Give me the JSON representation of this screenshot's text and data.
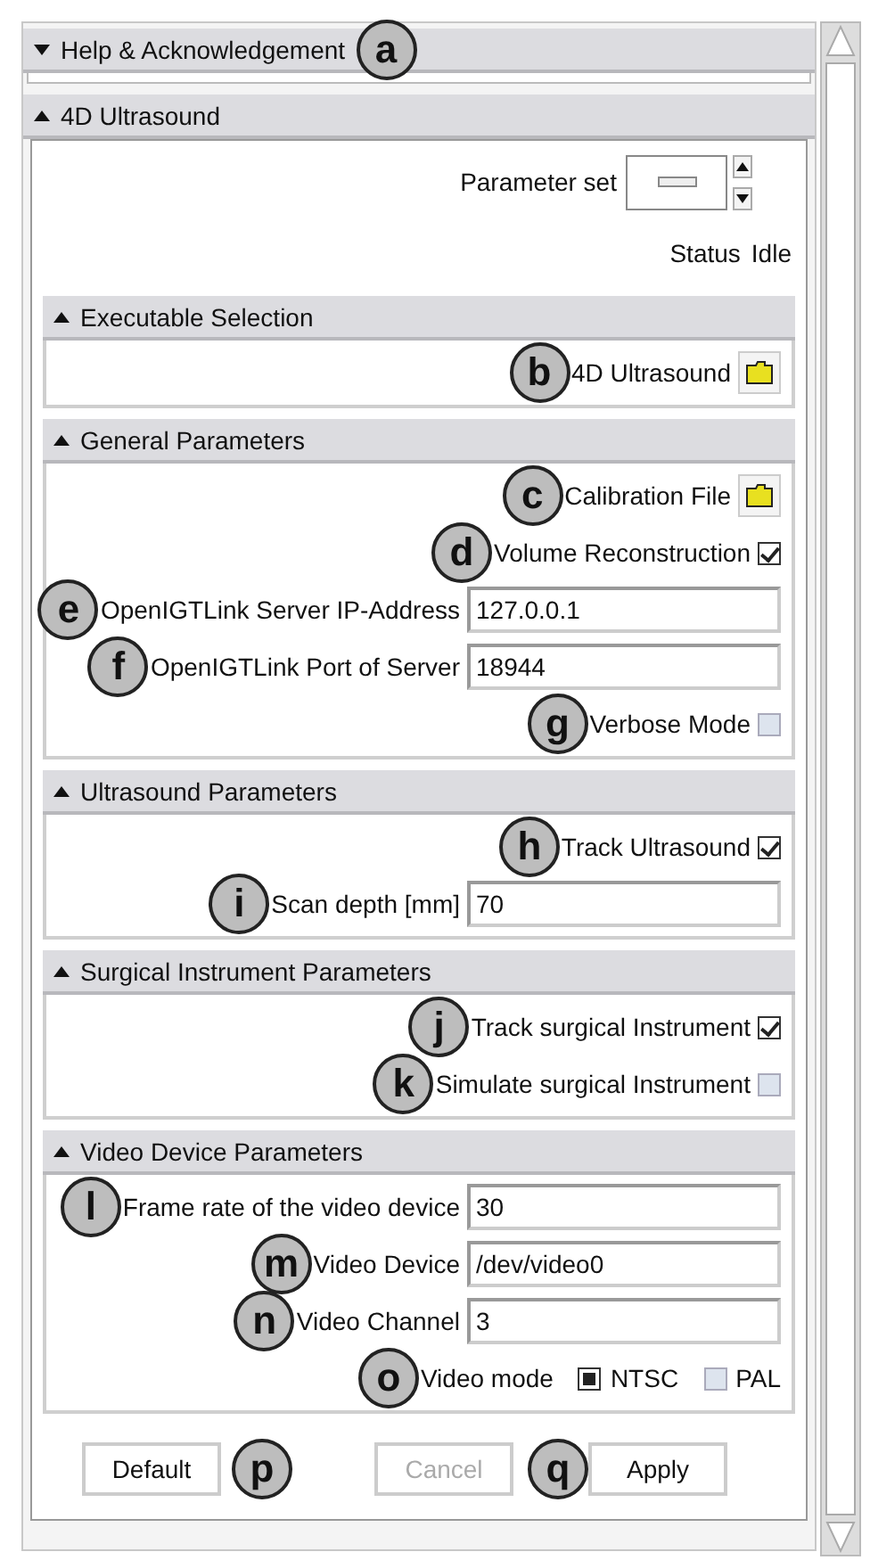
{
  "help_panel": {
    "title": "Help & Acknowledgement",
    "expanded": false,
    "callout": "a"
  },
  "module_panel": {
    "title": "4D Ultrasound",
    "expanded": true,
    "parameter_set": {
      "label": "Parameter set"
    },
    "status": {
      "label": "Status",
      "value": "Idle"
    },
    "groups": [
      {
        "title": "Executable Selection",
        "expanded": true,
        "rows": [
          {
            "kind": "file",
            "label": "4D Ultrasound",
            "callout": "b"
          }
        ]
      },
      {
        "title": "General Parameters",
        "expanded": true,
        "rows": [
          {
            "kind": "file",
            "label": "Calibration File",
            "callout": "c"
          },
          {
            "kind": "checkbox",
            "label": "Volume Reconstruction",
            "checked": true,
            "callout": "d"
          },
          {
            "kind": "text",
            "label": "OpenIGTLink Server IP-Address",
            "value": "127.0.0.1",
            "callout": "e"
          },
          {
            "kind": "text",
            "label": "OpenIGTLink Port of Server",
            "value": "18944",
            "callout": "f"
          },
          {
            "kind": "checkbox",
            "label": "Verbose Mode",
            "checked": false,
            "callout": "g"
          }
        ]
      },
      {
        "title": "Ultrasound Parameters",
        "expanded": true,
        "rows": [
          {
            "kind": "checkbox",
            "label": "Track Ultrasound",
            "checked": true,
            "callout": "h"
          },
          {
            "kind": "text",
            "label": "Scan depth [mm]",
            "value": "70",
            "callout": "i"
          }
        ]
      },
      {
        "title": "Surgical Instrument Parameters",
        "expanded": true,
        "rows": [
          {
            "kind": "checkbox",
            "label": "Track surgical Instrument",
            "checked": true,
            "callout": "j"
          },
          {
            "kind": "checkbox",
            "label": "Simulate surgical Instrument",
            "checked": false,
            "callout": "k"
          }
        ]
      },
      {
        "title": "Video Device Parameters",
        "expanded": true,
        "rows": [
          {
            "kind": "text",
            "label": "Frame rate of the video device",
            "value": "30",
            "callout": "l"
          },
          {
            "kind": "text",
            "label": "Video Device",
            "value": "/dev/video0",
            "callout": "m"
          },
          {
            "kind": "text",
            "label": "Video Channel",
            "value": "3",
            "callout": "n"
          },
          {
            "kind": "radio",
            "label": "Video mode",
            "callout": "o",
            "options": [
              {
                "label": "NTSC",
                "selected": true
              },
              {
                "label": "PAL",
                "selected": false
              }
            ]
          }
        ]
      }
    ],
    "buttons": [
      {
        "label": "Default",
        "disabled": false,
        "callout": "p"
      },
      {
        "label": "Cancel",
        "disabled": true
      },
      {
        "label": "Apply",
        "disabled": false,
        "callout": "q"
      }
    ]
  }
}
